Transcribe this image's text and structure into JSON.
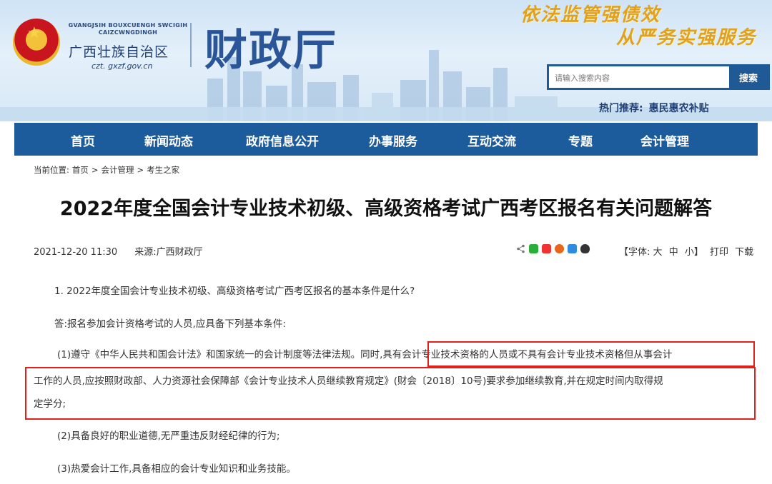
{
  "header": {
    "region_en_line1": "GVANGJSIH BOUXCUENGH SWCIGIH",
    "region_en_line2": "CAIZCWNGDINGH",
    "region_cn": "广西壮族自治区",
    "url": "czt. gxzf.gov.cn",
    "site_title": "财政厅",
    "slogan_line1": "依法监管强债效",
    "slogan_line2": "从严务实强服务",
    "search_placeholder": "请输入搜索内容",
    "search_button": "搜索",
    "hot_label": "热门推荐:",
    "hot_item": "惠民惠农补贴"
  },
  "nav": {
    "items": [
      "首页",
      "新闻动态",
      "政府信息公开",
      "办事服务",
      "互动交流",
      "专题",
      "会计管理"
    ]
  },
  "breadcrumb": {
    "label": "当前位置:",
    "items": [
      "首页",
      "会计管理",
      "考生之家"
    ],
    "sep": ">"
  },
  "article": {
    "title": "2022年度全国会计专业技术初级、高级资格考试广西考区报名有关问题解答",
    "datetime": "2021-12-20 11:30",
    "source": "来源:广西财政厅",
    "font_label": "【字体:",
    "font_sizes": [
      "大",
      "中",
      "小"
    ],
    "font_close": "】",
    "print": "打印",
    "download": "下载",
    "q1": "1. 2022年度全国会计专业技术初级、高级资格考试广西考区报名的基本条件是什么?",
    "a_intro": "答:报名参加会计资格考试的人员,应具备下列基本条件:",
    "c1_line1": "(1)遵守《中华人民共和国会计法》和国家统一的会计制度等法律法规。同时,具有会计专业技术资格的人员或不具有会计专业技术资格但从事会计",
    "c1_line2": "工作的人员,应按照财政部、人力资源社会保障部《会计专业技术人员继续教育规定》(财会〔2018〕10号)要求参加继续教育,并在规定时间内取得规",
    "c1_line3": "定学分;",
    "c2": "(2)具备良好的职业道德,无严重违反财经纪律的行为;",
    "c3": "(3)热爱会计工作,具备相应的会计专业知识和业务技能。"
  },
  "share_icons": [
    "share-icon",
    "wechat-icon",
    "qzone-icon",
    "weibo-icon",
    "tencent-icon",
    "qq-icon"
  ],
  "colors": {
    "nav_bg": "#1d5c9c",
    "highlight_border": "#e0201a",
    "title_blue": "#2a5599"
  }
}
